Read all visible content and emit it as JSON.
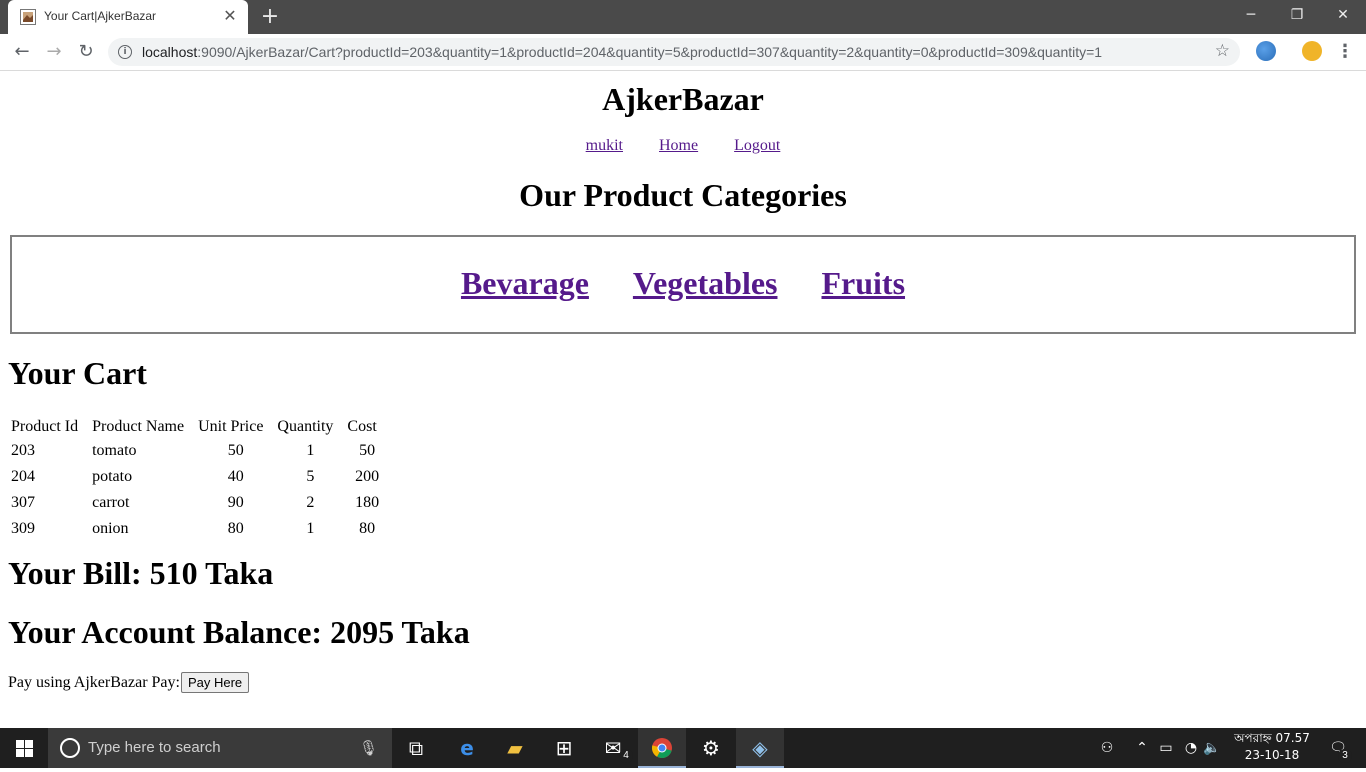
{
  "browser": {
    "tab_title": "Your Cart|AjkerBazar",
    "tab_close": "✕",
    "new_tab": "+",
    "url_host": "localhost",
    "url_rest": ":9090/AjkerBazar/Cart?productId=203&quantity=1&productId=204&quantity=5&productId=307&quantity=2&quantity=0&productId=309&quantity=1",
    "icons": [
      "back-icon",
      "forward-icon",
      "reload-icon",
      "info-icon",
      "bookmark-star-icon",
      "menu-icon"
    ]
  },
  "header": {
    "site_title": "AjkerBazar",
    "nav": {
      "user": "mukit",
      "home": "Home",
      "logout": "Logout"
    }
  },
  "categories": {
    "heading": "Our Product Categories",
    "items": [
      "Bevarage",
      "Vegetables",
      "Fruits"
    ]
  },
  "cart": {
    "heading": "Your Cart",
    "columns": [
      "Product Id",
      "Product Name",
      "Unit Price",
      "Quantity",
      "Cost"
    ],
    "rows": [
      [
        "203",
        "tomato",
        "50",
        "1",
        "50"
      ],
      [
        "204",
        "potato",
        "40",
        "5",
        "200"
      ],
      [
        "307",
        "carrot",
        "90",
        "2",
        "180"
      ],
      [
        "309",
        "onion",
        "80",
        "1",
        "80"
      ]
    ]
  },
  "summary": {
    "bill": "Your Bill: 510 Taka",
    "balance": "Your Account Balance: 2095 Taka",
    "pay_label": "Pay using AjkerBazar Pay:",
    "pay_button": "Pay Here"
  },
  "taskbar": {
    "search_placeholder": "Type here to search",
    "mail_badge": "4",
    "clock_time": "অপরাহ্ন 07.57",
    "clock_date": "23-10-18",
    "notification_badge": "3"
  }
}
